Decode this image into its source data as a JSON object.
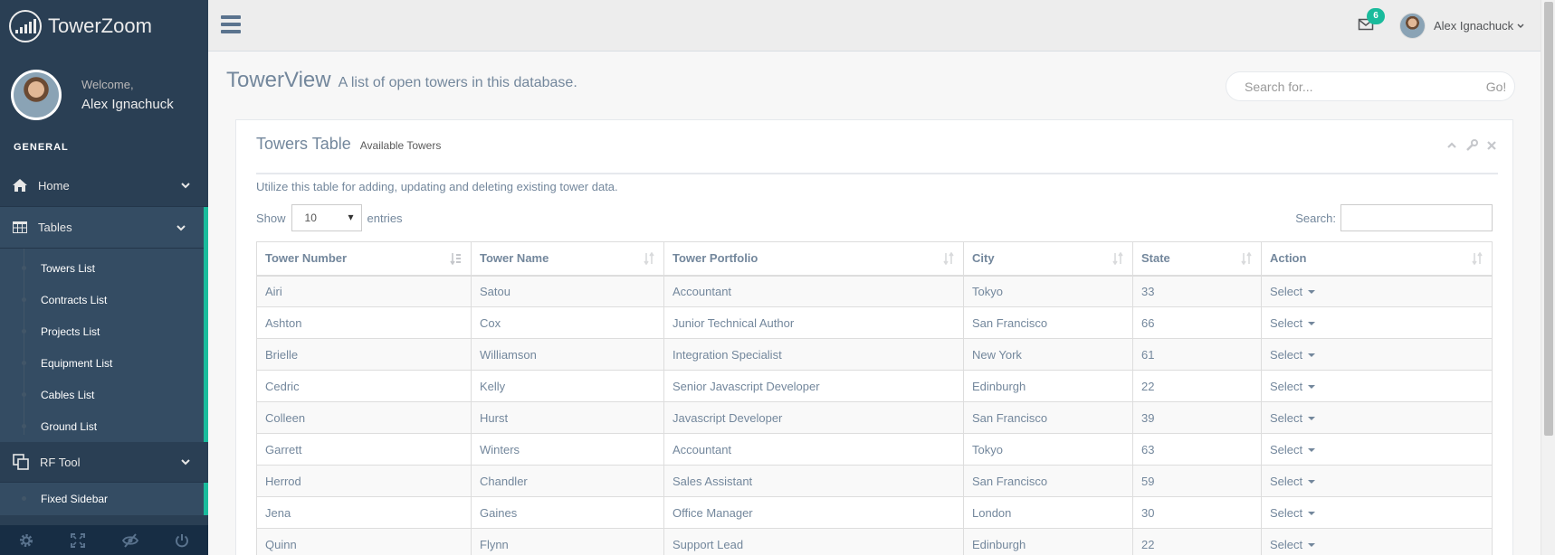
{
  "app": {
    "brand": "TowerZoom"
  },
  "profile": {
    "welcome": "Welcome,",
    "name": "Alex Ignachuck"
  },
  "sidebar": {
    "section_title": "GENERAL",
    "home_label": "Home",
    "tables_label": "Tables",
    "tables_items": [
      {
        "label": "Towers List"
      },
      {
        "label": "Contracts List"
      },
      {
        "label": "Projects List"
      },
      {
        "label": "Equipment List"
      },
      {
        "label": "Cables List"
      },
      {
        "label": "Ground List"
      }
    ],
    "rf_label": "RF Tool",
    "fixed_label": "Fixed Sidebar",
    "footer_icons": [
      "gear-icon",
      "fullscreen-icon",
      "eye-slash-icon",
      "power-icon"
    ]
  },
  "topnav": {
    "mail_count": "6",
    "user_name": "Alex Ignachuck"
  },
  "page": {
    "title": "TowerView",
    "subtitle": "A list of open towers in this database.",
    "search_placeholder": "Search for...",
    "search_go": "Go!"
  },
  "panel": {
    "title": "Towers Table",
    "subtitle": "Available Towers",
    "intro": "Utilize this table for adding, updating and deleting existing tower data.",
    "show_label": "Show",
    "entries_value": "10",
    "entries_label": "entries",
    "search_label": "Search:"
  },
  "table": {
    "columns": [
      "Tower Number",
      "Tower Name",
      "Tower Portfolio",
      "City",
      "State",
      "Action"
    ],
    "rows": [
      [
        "Airi",
        "Satou",
        "Accountant",
        "Tokyo",
        "33",
        "Select"
      ],
      [
        "Ashton",
        "Cox",
        "Junior Technical Author",
        "San Francisco",
        "66",
        "Select"
      ],
      [
        "Brielle",
        "Williamson",
        "Integration Specialist",
        "New York",
        "61",
        "Select"
      ],
      [
        "Cedric",
        "Kelly",
        "Senior Javascript Developer",
        "Edinburgh",
        "22",
        "Select"
      ],
      [
        "Colleen",
        "Hurst",
        "Javascript Developer",
        "San Francisco",
        "39",
        "Select"
      ],
      [
        "Garrett",
        "Winters",
        "Accountant",
        "Tokyo",
        "63",
        "Select"
      ],
      [
        "Herrod",
        "Chandler",
        "Sales Assistant",
        "San Francisco",
        "59",
        "Select"
      ],
      [
        "Jena",
        "Gaines",
        "Office Manager",
        "London",
        "30",
        "Select"
      ],
      [
        "Quinn",
        "Flynn",
        "Support Lead",
        "Edinburgh",
        "22",
        "Select"
      ]
    ]
  },
  "colors": {
    "sidebar": "#2a3f54",
    "accent": "#1abb9c",
    "text": "#73879c"
  }
}
